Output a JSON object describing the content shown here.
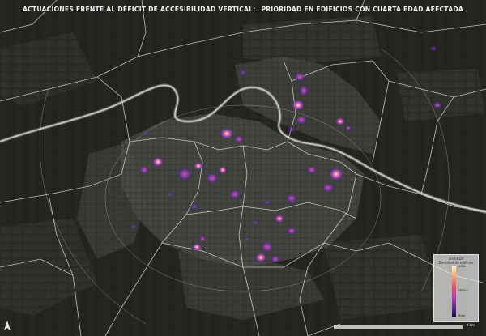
{
  "header": {
    "title_part1": "ACTUACIONES FRENTE AL DÉFICIT DE ACCESIBILIDAD VERTICAL:",
    "title_part2": "PRIORIDAD EN EDIFICIOS CON CUARTA EDAD AFECTADA"
  },
  "legend": {
    "title": "LEYENDA",
    "subtitle": "Densidad de edificios",
    "high": "ALTA",
    "mid": "MEDIA",
    "low": "BAJA"
  },
  "scale": {
    "label": "1 km"
  },
  "icons": {
    "north": "north-arrow-icon"
  },
  "colors": {
    "background": "#23241f",
    "boundary": "#d8d8d8",
    "river": "#bcbcbc",
    "hotspot_low": "#5a2fa0",
    "hotspot_mid": "#d9479a",
    "hotspot_high": "#ffe3b5"
  }
}
